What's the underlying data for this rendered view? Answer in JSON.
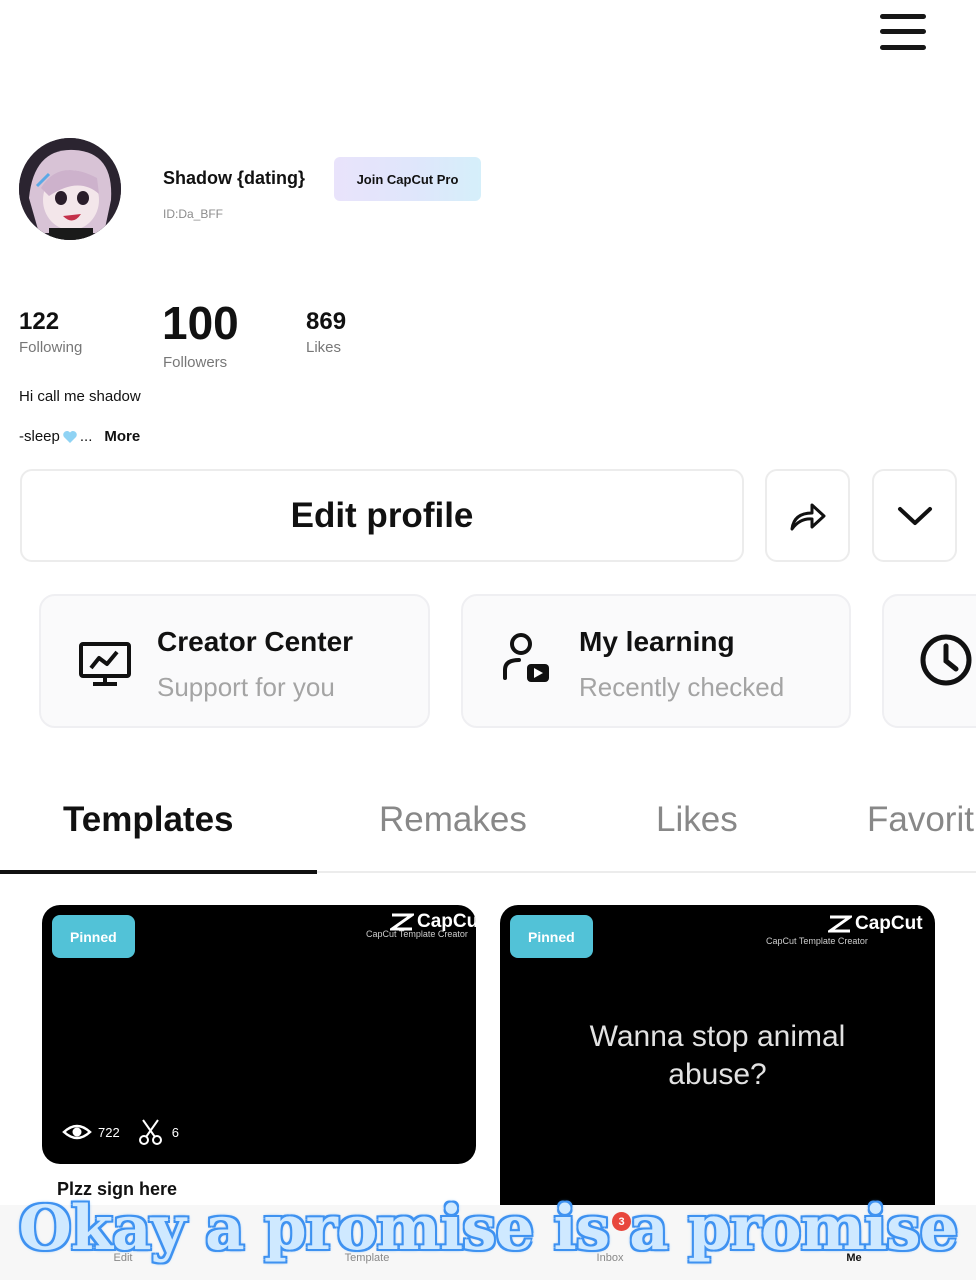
{
  "profile": {
    "name": "Shadow {dating}",
    "id": "ID:Da_BFF",
    "pro_button": "Join CapCut Pro",
    "stats": {
      "following": {
        "value": "122",
        "label": "Following"
      },
      "followers": {
        "value": "100",
        "label": "Followers"
      },
      "likes": {
        "value": "869",
        "label": "Likes"
      }
    },
    "bio_line1": "Hi call me shadow",
    "bio_line2_start": "-sleep",
    "bio_line2_ellipsis": "...",
    "bio_more": "More"
  },
  "actions": {
    "edit_profile": "Edit profile"
  },
  "cards": [
    {
      "title": "Creator Center",
      "subtitle": "Support for you"
    },
    {
      "title": "My learning",
      "subtitle": "Recently checked"
    }
  ],
  "tabs": [
    "Templates",
    "Remakes",
    "Likes",
    "Favorit"
  ],
  "videos": [
    {
      "badge": "Pinned",
      "watermark": "CapCut",
      "watermark_sub": "CapCut Template Creator",
      "views": "722",
      "uses": "6",
      "title": "Plzz sign here"
    },
    {
      "badge": "Pinned",
      "watermark": "CapCut",
      "watermark_sub": "CapCut Template Creator",
      "caption_line1": "Wanna stop animal",
      "caption_line2": "abuse?"
    }
  ],
  "bottom_nav": {
    "items": [
      "Edit",
      "Template",
      "Inbox",
      "Me"
    ],
    "inbox_badge": "3"
  },
  "overlay_text": "Okay a promise is a promise",
  "colors": {
    "pinned": "#52c2d7",
    "badge": "#e8473d",
    "overlay": "#cfe9ff"
  }
}
